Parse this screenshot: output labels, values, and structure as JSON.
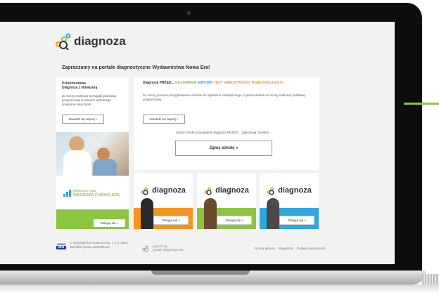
{
  "brand": {
    "name": "diagnoza",
    "green": "#8cc63f",
    "orange": "#f7941d",
    "blue": "#29a9e0"
  },
  "headline": "Zapraszamy na portale diagnostyczne Wydawnictwa Nowa Era!",
  "left_panel": {
    "title_line1": "Przedmiotowa",
    "title_line2": "Diagnoza z Nową Erą",
    "description": "do oceny realizacji wymagań podstawy programowej w ramach wybranego programu nauczania",
    "more_button": "dowiedz się więcej »",
    "logo_line1": "PRZEDMIOTOWA",
    "logo_line2": "DIAGNOZA Z NOWĄ ERĄ",
    "login_button": "Zaloguj się »"
  },
  "right_panel": {
    "title_part1": "Diagnoza PRZED...",
    "title_part2": "EGZAMINEM",
    "title_part3": "MATURĄ",
    "title_part4": "TEST UMIEJĘTNOŚCI TRZECIOKLASISTY",
    "description": "do oceny poziomu przygotowania uczniów do egzaminu zewnętrznego, a jednocześnie do oceny realizacji podstawy programowej.",
    "more_button": "dowiedz się więcej »",
    "participation_info": "Udział szkoły w programie diagnoza PRZED... zgłasza jej Dyrektor.",
    "register_button": "Zgłoś szkołę »"
  },
  "tiles": [
    {
      "logo": "diagnoza",
      "login_button": "Zaloguj się »",
      "color": "#f7941d"
    },
    {
      "logo": "diagnoza",
      "login_button": "Zaloguj się »",
      "color": "#8cc63f"
    },
    {
      "logo": "diagnoza",
      "login_button": "Zaloguj się »",
      "color": "#29a9e0"
    }
  ],
  "footer": {
    "publisher_logo_top": "nowa",
    "publisher_logo_bottom": "era",
    "copyright_line1": "© Copyright by Nowa Era Sp. z o.o. 2014",
    "copyright_line2": "Wszelkie prawa zastrzeżone.",
    "powered_line1": "powerd by",
    "powered_line2": "portale diagnostyczne",
    "links": [
      "Strona główna",
      "Regulamin",
      "Polityka prywatności"
    ]
  }
}
